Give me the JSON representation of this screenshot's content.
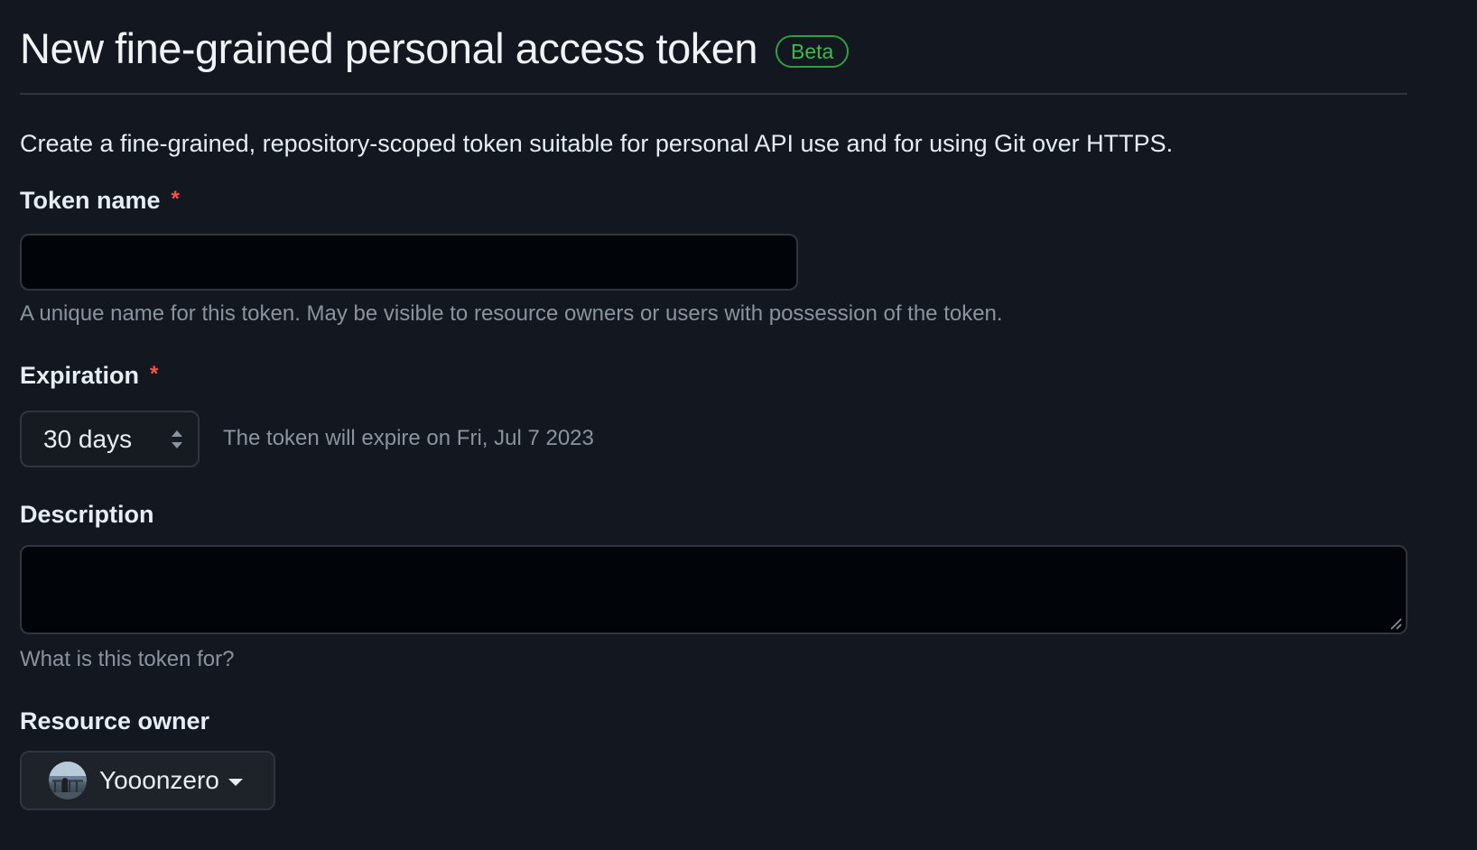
{
  "header": {
    "title": "New fine-grained personal access token",
    "badge": "Beta"
  },
  "intro": "Create a fine-grained, repository-scoped token suitable for personal API use and for using Git over HTTPS.",
  "token_name": {
    "label": "Token name",
    "required_mark": "*",
    "value": "",
    "hint": "A unique name for this token. May be visible to resource owners or users with possession of the token."
  },
  "expiration": {
    "label": "Expiration",
    "required_mark": "*",
    "selected": "30 days",
    "note": "The token will expire on Fri, Jul 7 2023"
  },
  "description": {
    "label": "Description",
    "value": "",
    "hint": "What is this token for?"
  },
  "resource_owner": {
    "label": "Resource owner",
    "selected": "Yooonzero"
  },
  "colors": {
    "background": "#121720",
    "badge_green": "#3fb950",
    "required_red": "#f85149",
    "muted_text": "#8b949e"
  },
  "icons": [
    "select-arrows-icon",
    "resize-handle-icon",
    "caret-down-icon",
    "avatar"
  ]
}
